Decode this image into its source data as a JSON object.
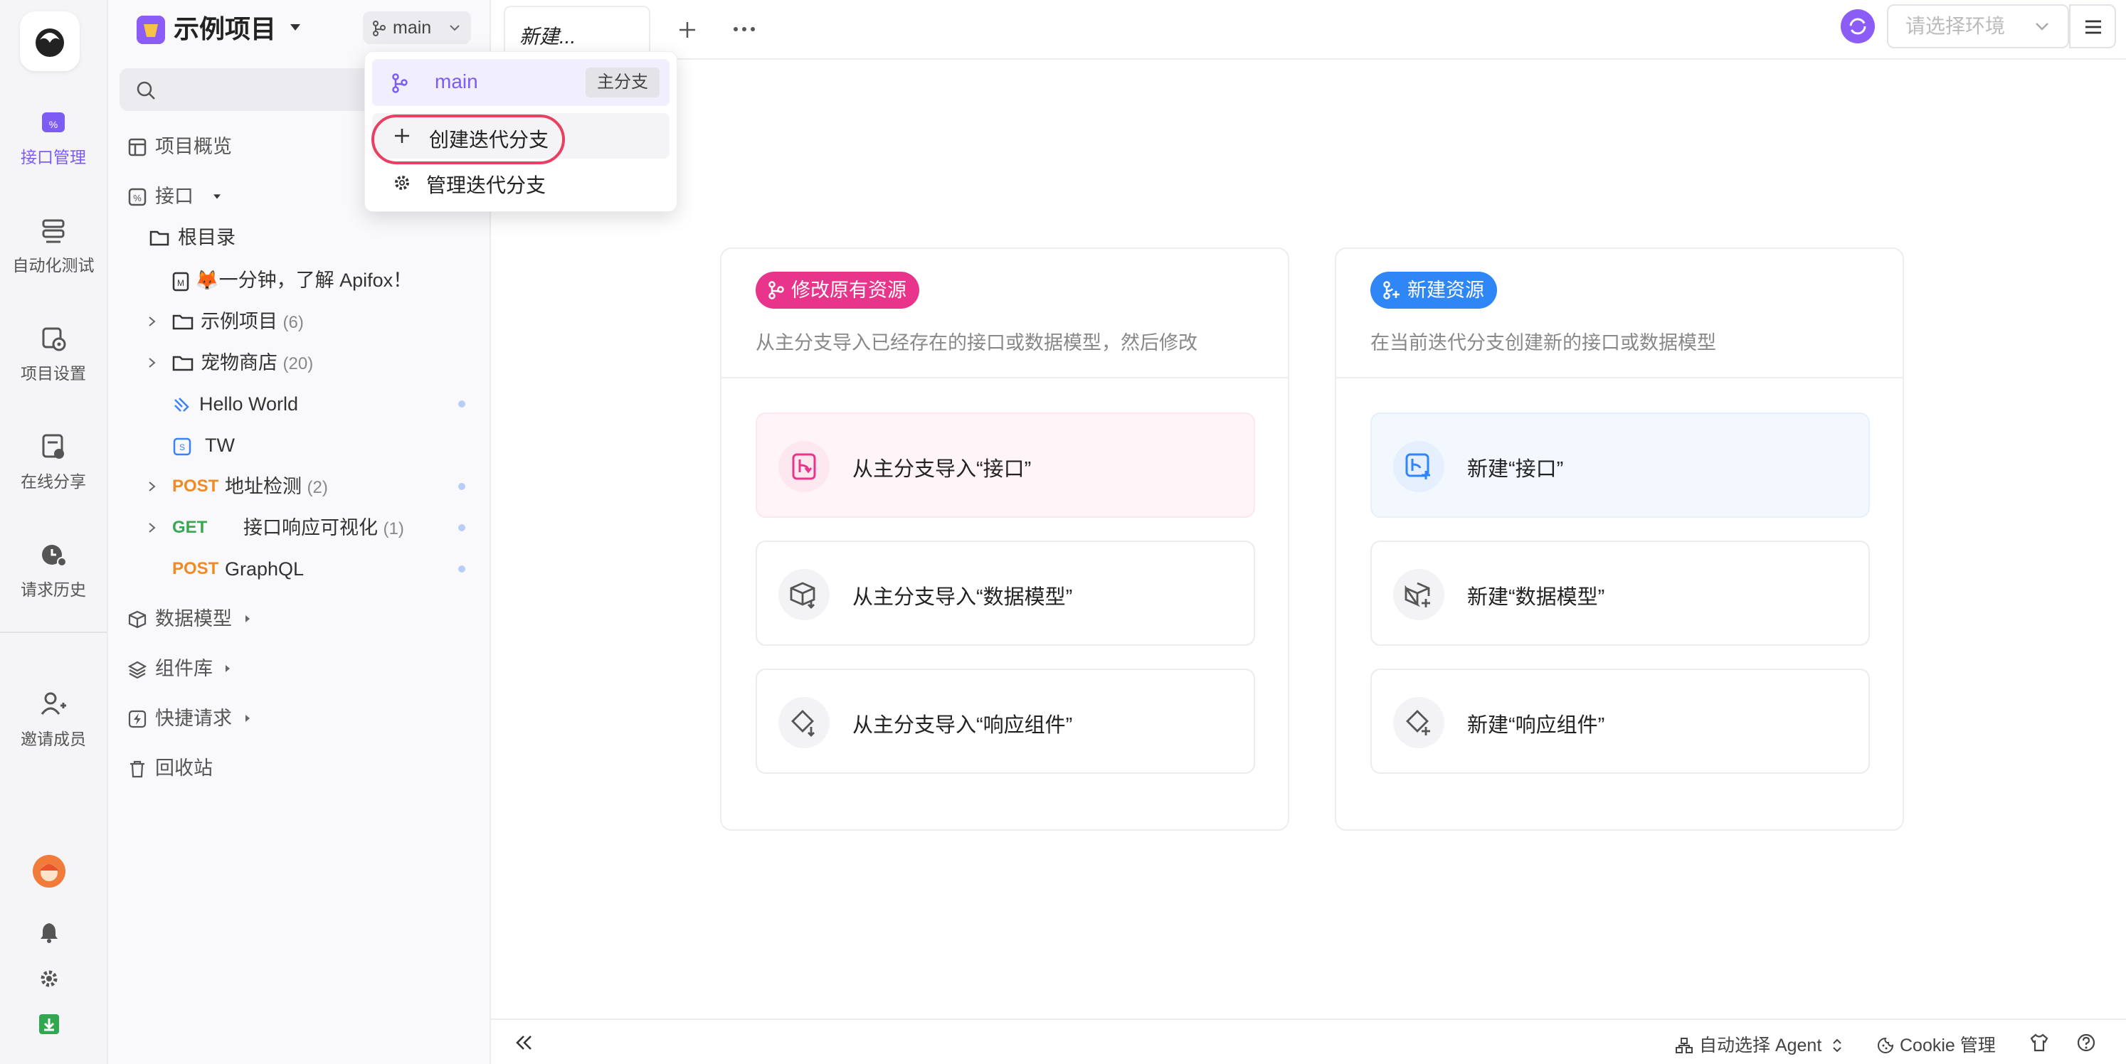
{
  "rail": {
    "items": [
      {
        "label": "接口管理",
        "icon": "api-management-icon"
      },
      {
        "label": "自动化测试",
        "icon": "automation-test-icon"
      },
      {
        "label": "项目设置",
        "icon": "project-settings-icon"
      },
      {
        "label": "在线分享",
        "icon": "online-share-icon"
      },
      {
        "label": "请求历史",
        "icon": "request-history-icon"
      },
      {
        "label": "邀请成员",
        "icon": "invite-member-icon"
      }
    ]
  },
  "project": {
    "title": "示例项目"
  },
  "branch": {
    "current": "main"
  },
  "dropdown": {
    "main_label": "main",
    "main_tag": "主分支",
    "create_label": "创建迭代分支",
    "manage_label": "管理迭代分支"
  },
  "sidebar": {
    "overview": "项目概览",
    "api": "接口",
    "root": "根目录",
    "doc": "🦊一分钟，了解 Apifox！",
    "folder1": {
      "name": "示例项目",
      "count": "(6)"
    },
    "folder2": {
      "name": "宠物商店",
      "count": "(20)"
    },
    "hello": "Hello World",
    "tw": "TW",
    "post1": {
      "method": "POST",
      "name": "地址检测",
      "count": "(2)"
    },
    "get1": {
      "method": "GET",
      "name": "接口响应可视化",
      "count": "(1)"
    },
    "post2": {
      "method": "POST",
      "name": "GraphQL"
    },
    "models": "数据模型",
    "components": "组件库",
    "quick": "快捷请求",
    "trash": "回收站"
  },
  "tabs": [
    {
      "label": "新建..."
    }
  ],
  "env": {
    "placeholder": "请选择环境"
  },
  "cards": [
    {
      "badge": "修改原有资源",
      "badge_color": "#e8348a",
      "desc": "从主分支导入已经存在的接口或数据模型，然后修改",
      "options": [
        "从主分支导入“接口”",
        "从主分支导入“数据模型”",
        "从主分支导入“响应组件”"
      ]
    },
    {
      "badge": "新建资源",
      "badge_color": "#2f86f6",
      "desc": "在当前迭代分支创建新的接口或数据模型",
      "options": [
        "新建“接口”",
        "新建“数据模型”",
        "新建“响应组件”"
      ]
    }
  ],
  "bottom": {
    "agent": "自动选择 Agent",
    "cookie": "Cookie 管理"
  }
}
